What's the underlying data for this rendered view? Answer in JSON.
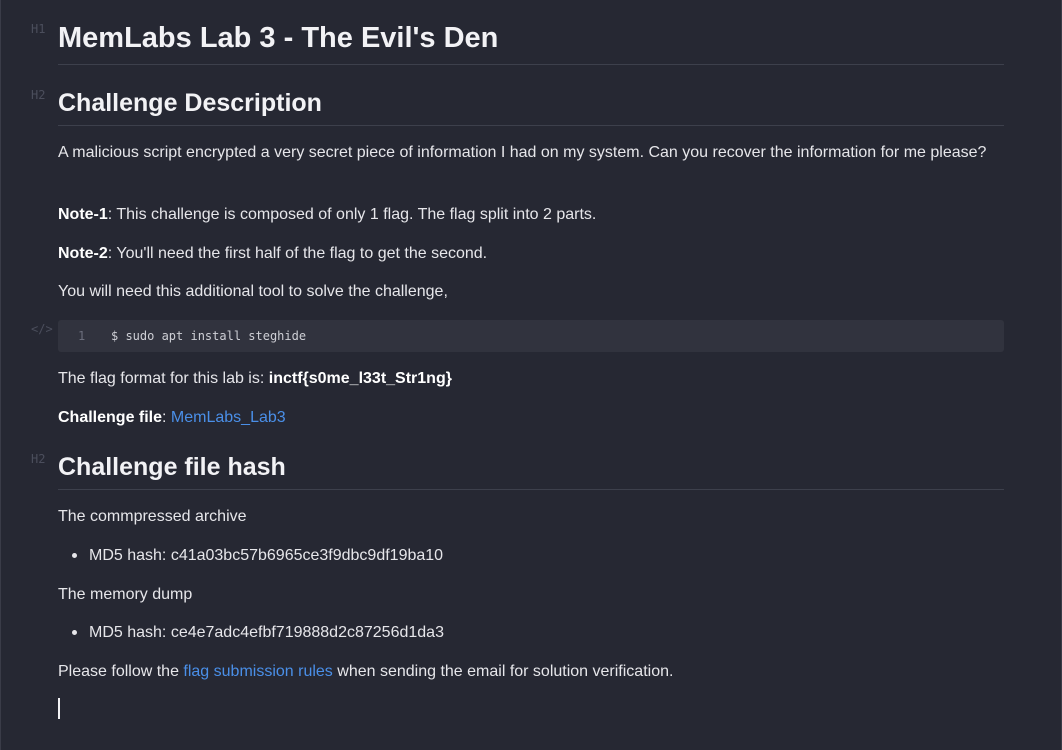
{
  "gutter": {
    "h1": "H1",
    "h2a": "H2",
    "code": "</>",
    "h2b": "H2"
  },
  "title": "MemLabs Lab 3 - The Evil's Den",
  "sections": {
    "description_heading": "Challenge Description",
    "hash_heading": "Challenge file hash"
  },
  "description": {
    "intro": "A malicious script encrypted a very secret piece of information I had on my system. Can you recover the information for me please?",
    "note1_label": "Note-1",
    "note1_text": ": This challenge is composed of only 1 flag. The flag split into 2 parts.",
    "note2_label": "Note-2",
    "note2_text": ": You'll need the first half of the flag to get the second.",
    "tool_text": "You will need this additional tool to solve the challenge,"
  },
  "code": {
    "line_number": "1",
    "command": "$ sudo apt install steghide"
  },
  "flag": {
    "prefix": "The flag format for this lab is: ",
    "format": "inctf{s0me_l33t_Str1ng}"
  },
  "challenge_file": {
    "label": "Challenge file",
    "separator": ": ",
    "link": "MemLabs_Lab3"
  },
  "hashes": {
    "archive_label": "The commpressed archive",
    "archive_md5": "MD5 hash: c41a03bc57b6965ce3f9dbc9df19ba10",
    "dump_label": "The memory dump",
    "dump_md5": "MD5 hash: ce4e7adc4efbf719888d2c87256d1da3"
  },
  "footer": {
    "before": "Please follow the ",
    "link": "flag submission rules",
    "after": " when sending the email for solution verification."
  }
}
